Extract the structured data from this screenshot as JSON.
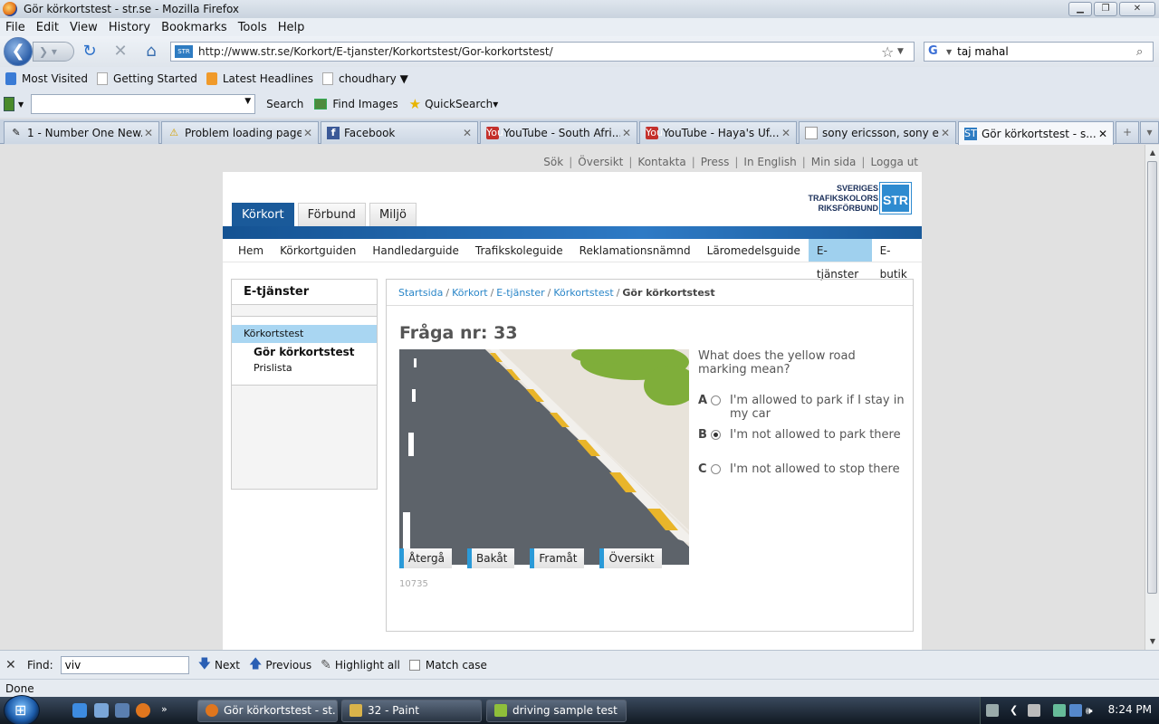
{
  "window": {
    "title": "Gör körkortstest - str.se - Mozilla Firefox"
  },
  "menu": [
    "File",
    "Edit",
    "View",
    "History",
    "Bookmarks",
    "Tools",
    "Help"
  ],
  "nav": {
    "url": "http://www.str.se/Korkort/E-tjanster/Korkortstest/Gor-korkortstest/",
    "site_icon": "STR",
    "search_value": "taj mahal"
  },
  "bookmarks": [
    "Most Visited",
    "Getting Started",
    "Latest Headlines",
    "choudhary ▼"
  ],
  "toolbar2": {
    "search_label": "Search",
    "find_images_label": "Find Images",
    "quicksearch_label": "QuickSearch▾"
  },
  "tabs": [
    {
      "label": "1 - Number One New...",
      "icon": "page-icon"
    },
    {
      "label": "Problem loading page",
      "icon": "warning-icon"
    },
    {
      "label": "Facebook",
      "icon": "facebook-icon"
    },
    {
      "label": "YouTube - South Afri...",
      "icon": "youtube-icon"
    },
    {
      "label": "YouTube - Haya's Uf...",
      "icon": "youtube-icon"
    },
    {
      "label": "sony ericsson, sony e...",
      "icon": "page-icon"
    },
    {
      "label": "Gör körkortstest - s...",
      "icon": "str-icon",
      "active": true
    }
  ],
  "site": {
    "toplinks": [
      "Sök",
      "Översikt",
      "Kontakta",
      "Press",
      "In English",
      "Min sida",
      "Logga ut"
    ],
    "logo": {
      "line1": "SVERIGES",
      "line2": "TRAFIKSKOLORS",
      "line3": "RIKSFÖRBUND",
      "mark": "STR"
    },
    "maintabs": [
      "Körkort",
      "Förbund",
      "Miljö"
    ],
    "subnav": [
      "Hem",
      "Körkortguiden",
      "Handledarguide",
      "Trafikskoleguide",
      "Reklamationsnämnd",
      "Läromedelsguide",
      "E-tjänster",
      "E-butik"
    ],
    "sidebar": {
      "heading": "E-tjänster",
      "item": "Körkortstest",
      "sub1": "Gör körkortstest",
      "sub2": "Prislista"
    },
    "breadcrumb": [
      "Startsida",
      "Körkort",
      "E-tjänster",
      "Körkortstest",
      "Gör körkortstest"
    ],
    "question": {
      "title": "Fråga nr: 33",
      "text": "What does the yellow road marking mean?",
      "answers": [
        {
          "letter": "A",
          "text": "I'm allowed to park if I stay in my car",
          "selected": false
        },
        {
          "letter": "B",
          "text": "I'm not allowed to park there",
          "selected": true
        },
        {
          "letter": "C",
          "text": "I'm not allowed to stop there",
          "selected": false
        }
      ],
      "buttons": [
        "Återgå",
        "Bakåt",
        "Framåt",
        "Översikt"
      ],
      "id": "10735"
    }
  },
  "findbar": {
    "label": "Find:",
    "value": "viv",
    "next": "Next",
    "previous": "Previous",
    "highlight": "Highlight all",
    "matchcase": "Match case"
  },
  "status": "Done",
  "taskbar": {
    "items": [
      "Gör körkortstest - st...",
      "32 - Paint",
      "driving sample test"
    ],
    "clock": "8:24 PM"
  }
}
